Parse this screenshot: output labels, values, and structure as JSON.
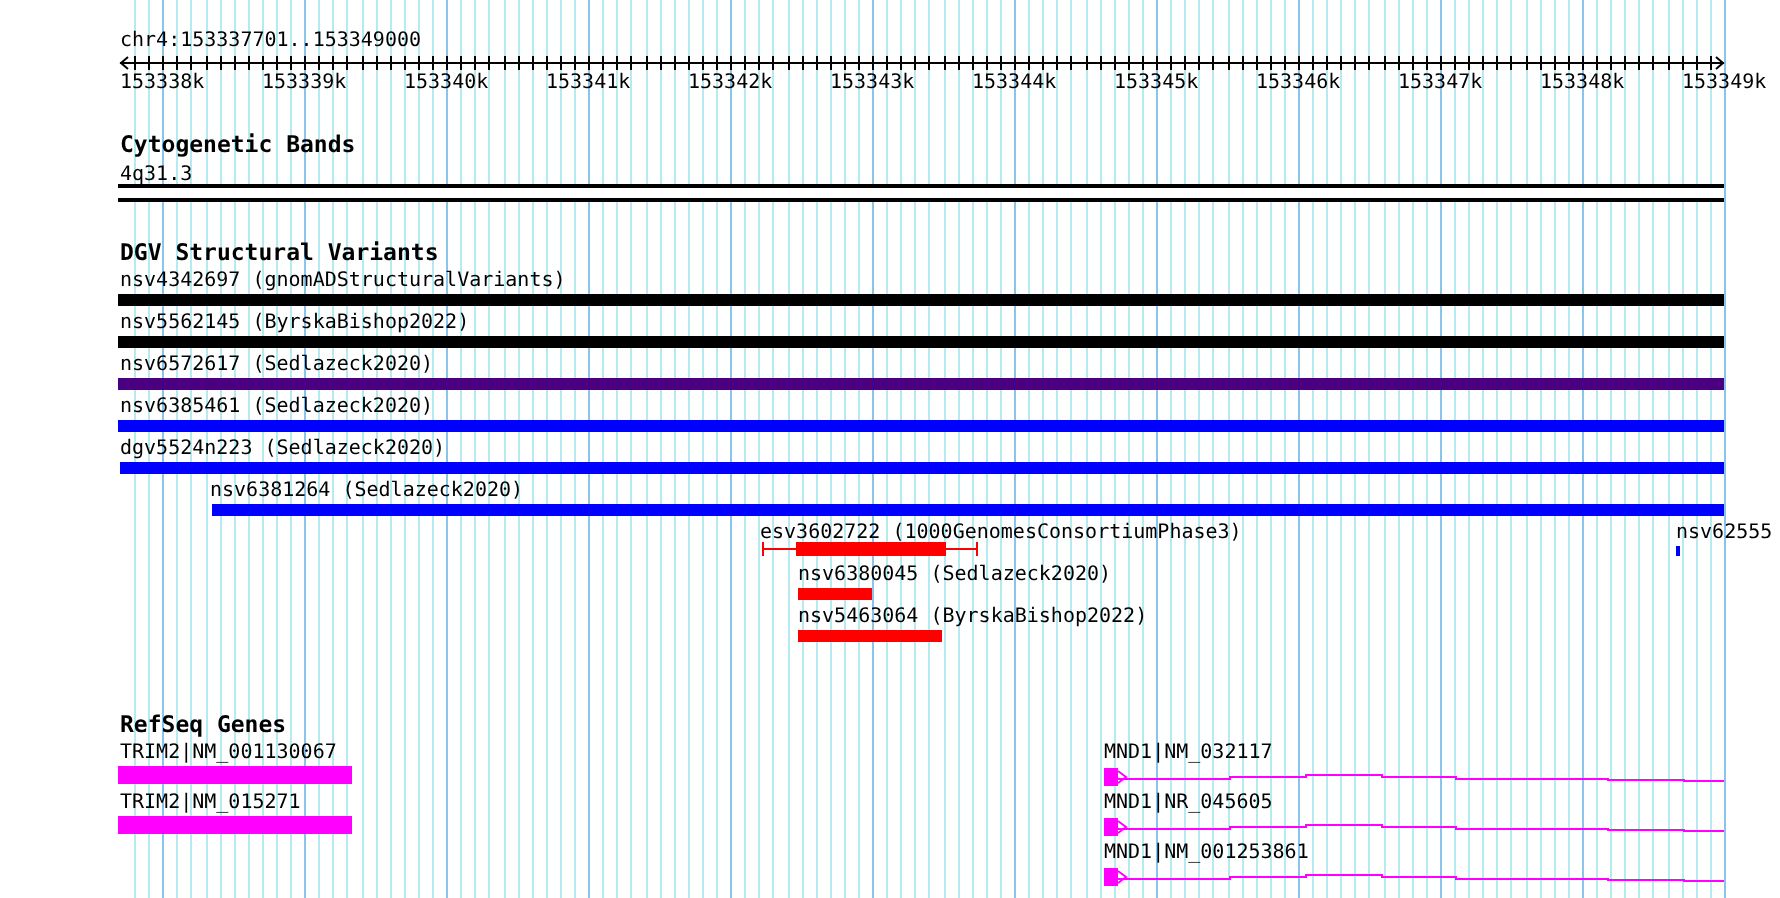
{
  "ruler": {
    "location": "chr4:153337701..153349000",
    "tick_labels": [
      "153338k",
      "153339k",
      "153340k",
      "153341k",
      "153342k",
      "153343k",
      "153344k",
      "153345k",
      "153346k",
      "153347k",
      "153348k",
      "153349k"
    ]
  },
  "cytogenetic_bands": {
    "title": "Cytogenetic Bands",
    "features": [
      {
        "label": "4q31.3"
      }
    ]
  },
  "dgv_structural_variants": {
    "title": "DGV Structural Variants",
    "features": [
      {
        "label": "nsv4342697 (gnomADStructuralVariants)",
        "kind": "bar",
        "color": "#000000"
      },
      {
        "label": "nsv5562145 (ByrskaBishop2022)",
        "kind": "bar",
        "color": "#000000"
      },
      {
        "label": "nsv6572617 (Sedlazeck2020)",
        "kind": "bar",
        "color": "#4b0082"
      },
      {
        "label": "nsv6385461 (Sedlazeck2020)",
        "kind": "bar",
        "color": "#0000ff"
      },
      {
        "label": "dgv5524n223 (Sedlazeck2020)",
        "kind": "bar",
        "color": "#0000ff"
      },
      {
        "label": "nsv6381264 (Sedlazeck2020)",
        "kind": "bar",
        "color": "#0000ff"
      },
      {
        "label": "esv3602722 (1000GenomesConsortiumPhase3)",
        "kind": "flanked",
        "color": "#ff0000"
      },
      {
        "label": "nsv62555",
        "kind": "point",
        "color": "#0000ff"
      },
      {
        "label": "nsv6380045 (Sedlazeck2020)",
        "kind": "bar",
        "color": "#ff0000"
      },
      {
        "label": "nsv5463064 (ByrskaBishop2022)",
        "kind": "bar",
        "color": "#ff0000"
      }
    ]
  },
  "refseq_genes": {
    "title": "RefSeq Genes",
    "features": [
      {
        "label": "TRIM2|NM_001130067",
        "kind": "block"
      },
      {
        "label": "TRIM2|NM_015271",
        "kind": "block"
      },
      {
        "label": "MND1|NM_032117",
        "kind": "intron_model"
      },
      {
        "label": "MND1|NR_045605",
        "kind": "intron_model"
      },
      {
        "label": "MND1|NM_001253861",
        "kind": "intron_model"
      }
    ]
  }
}
